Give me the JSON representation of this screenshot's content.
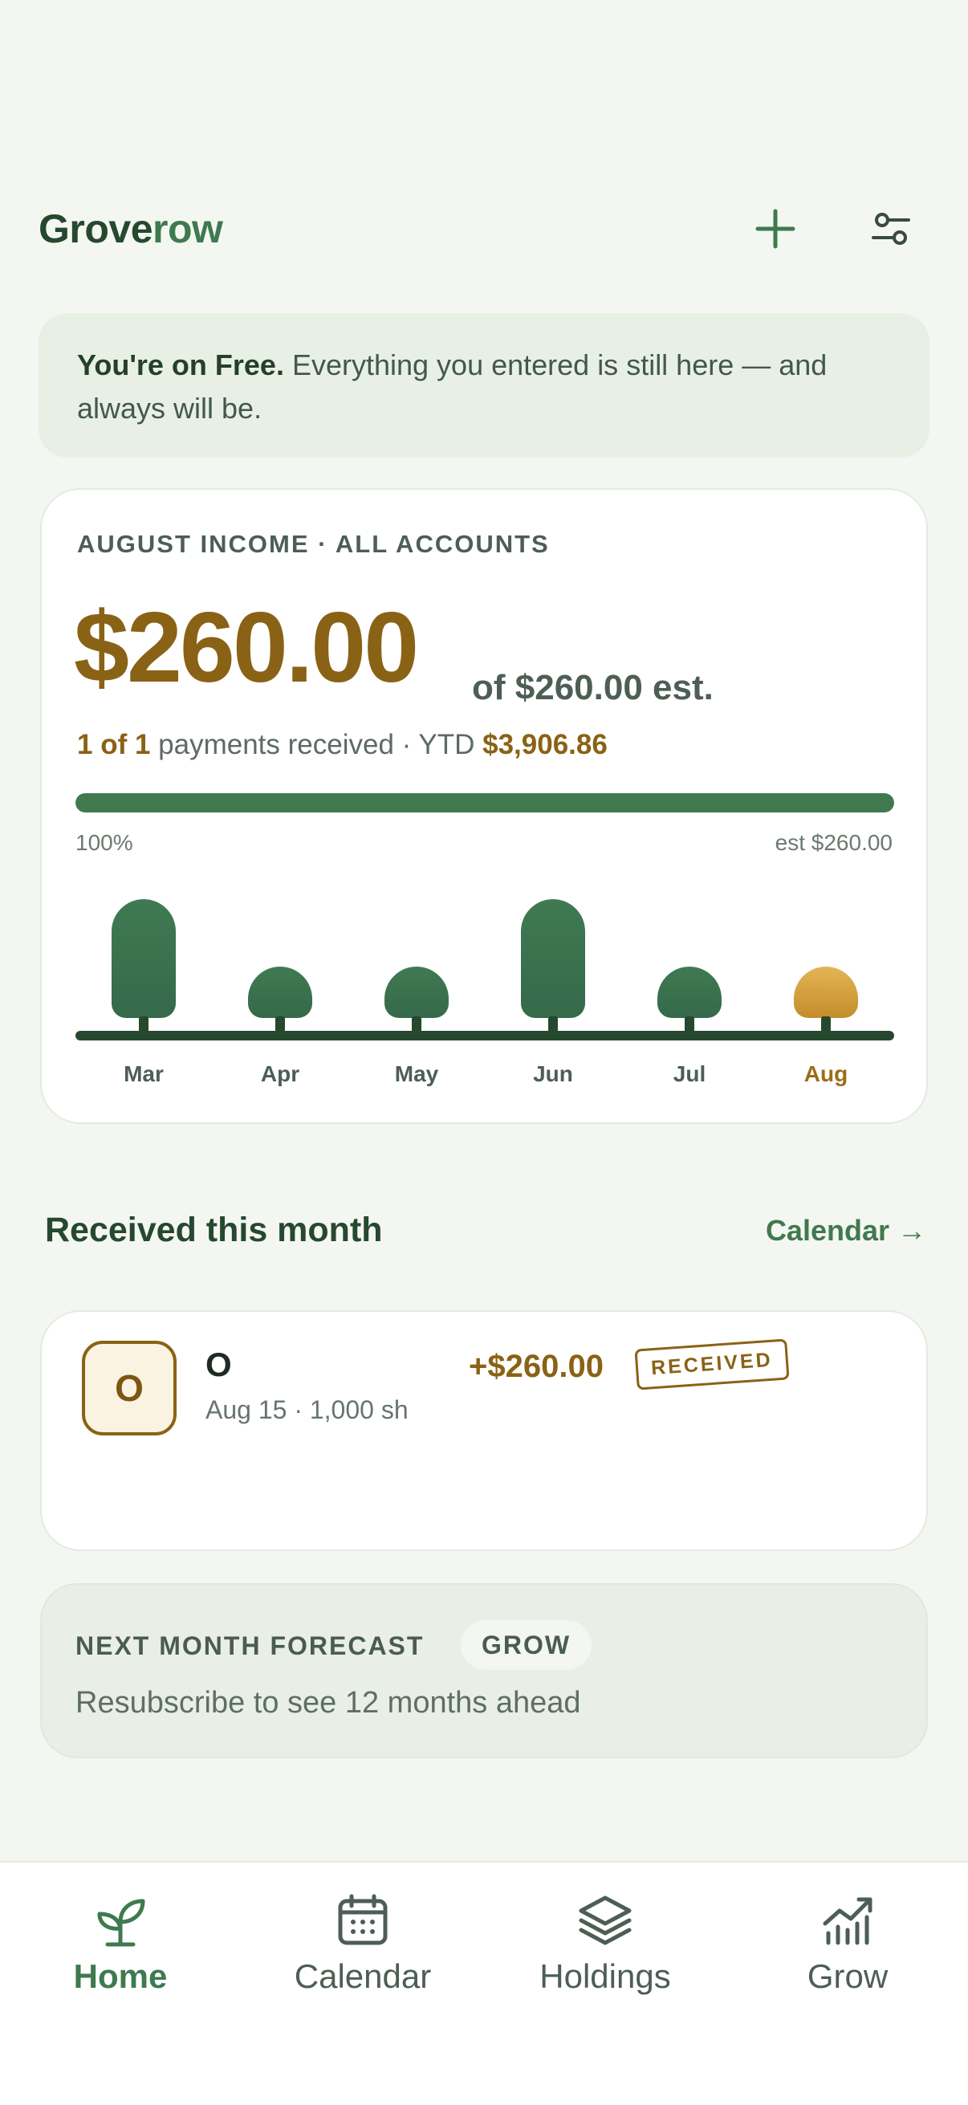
{
  "app": {
    "logo_part1": "Grove",
    "logo_part2": "row"
  },
  "banner": {
    "bold": "You're on Free.",
    "text": " Everything you entered is still here — and always will be."
  },
  "income": {
    "eyebrow": "AUGUST INCOME · ALL ACCOUNTS",
    "amount": "$260.00",
    "of_est": "of $260.00 est.",
    "payments_count": "1 of 1",
    "payments_text": " payments received · YTD ",
    "ytd": "$3,906.86",
    "progress_percent": 100,
    "progress_label": "100%",
    "est_label": "est $260.00"
  },
  "chart_data": {
    "type": "bar",
    "categories": [
      "Mar",
      "Apr",
      "May",
      "Jun",
      "Jul",
      "Aug"
    ],
    "values": [
      2,
      1,
      1,
      2,
      1,
      1
    ],
    "highlight_index": 5,
    "colors": {
      "past": "#3f7a52",
      "current": "#d9a441"
    }
  },
  "received": {
    "title": "Received this month",
    "link": "Calendar →",
    "items": [
      {
        "badge": "O",
        "ticker": "O",
        "detail": "Aug 15 · 1,000 sh",
        "amount": "+$260.00",
        "status": "RECEIVED"
      }
    ]
  },
  "forecast": {
    "title": "NEXT MONTH FORECAST",
    "pill": "GROW",
    "subtitle": "Resubscribe to see 12 months ahead"
  },
  "nav": {
    "items": [
      {
        "label": "Home",
        "icon": "sprout-icon",
        "active": true
      },
      {
        "label": "Calendar",
        "icon": "calendar-icon",
        "active": false
      },
      {
        "label": "Holdings",
        "icon": "layers-icon",
        "active": false
      },
      {
        "label": "Grow",
        "icon": "chart-up-icon",
        "active": false
      }
    ]
  },
  "colors": {
    "accent_green": "#3e7a4f",
    "dark_green": "#26482f",
    "gold": "#8a6215",
    "background": "#f4f7f1"
  }
}
